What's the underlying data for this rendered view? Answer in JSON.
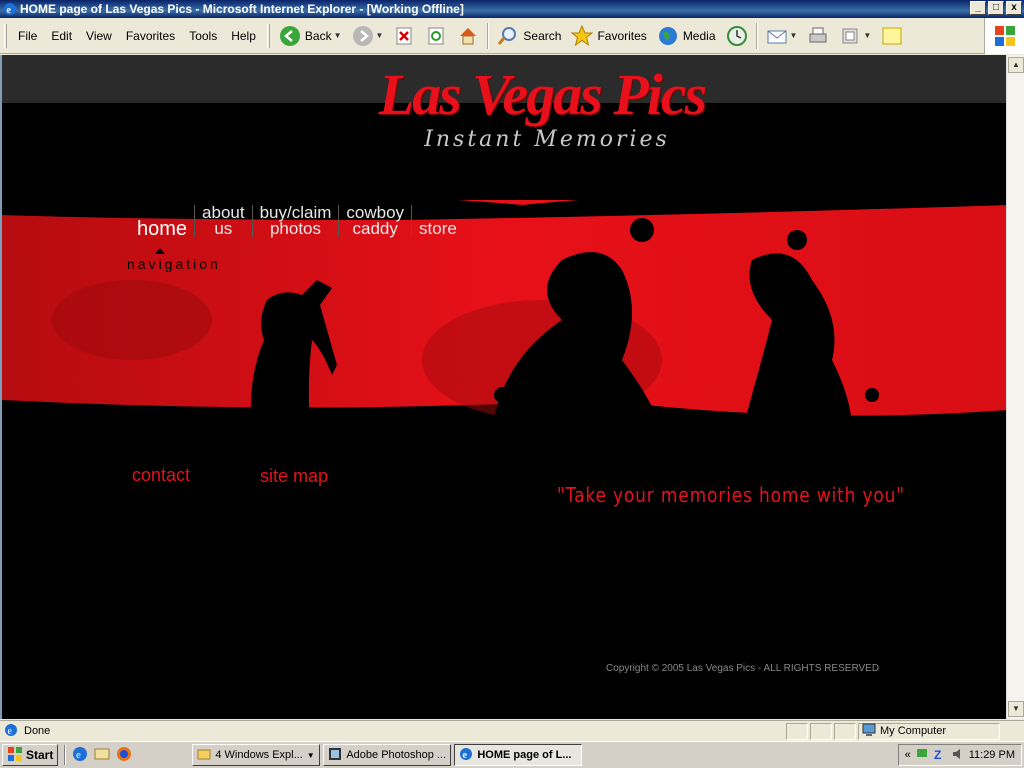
{
  "window": {
    "title": "HOME page of Las Vegas Pics - Microsoft Internet Explorer - [Working Offline]",
    "min": "_",
    "max": "□",
    "close": "x"
  },
  "menu": [
    "File",
    "Edit",
    "View",
    "Favorites",
    "Tools",
    "Help"
  ],
  "toolbar": {
    "back": "Back",
    "search": "Search",
    "favorites": "Favorites",
    "media": "Media"
  },
  "site": {
    "title": "Las Vegas Pics",
    "subtitle": "Instant Memories",
    "nav": {
      "home": "home",
      "about_1": "about",
      "about_2": "us",
      "buy_1": "buy/claim",
      "buy_2": "photos",
      "cowboy_1": "cowboy",
      "cowboy_2": "caddy",
      "store": "store",
      "caption": "navigation"
    },
    "contact": "contact",
    "sitemap": "site map",
    "tagline": "\"Take your memories home with you\"",
    "copyright": "Copyright © 2005 Las Vegas Pics - ALL RIGHTS RESERVED"
  },
  "status": {
    "text": "Done",
    "zone": "My Computer"
  },
  "taskbar": {
    "start": "Start",
    "tasks": [
      "4 Windows Expl...",
      "Adobe Photoshop ...",
      "HOME page of L..."
    ],
    "time": "11:29 PM",
    "tray_expand": "«"
  },
  "colors": {
    "brand_red": "#e8101a",
    "xp_titlebar": "#0a246a"
  }
}
